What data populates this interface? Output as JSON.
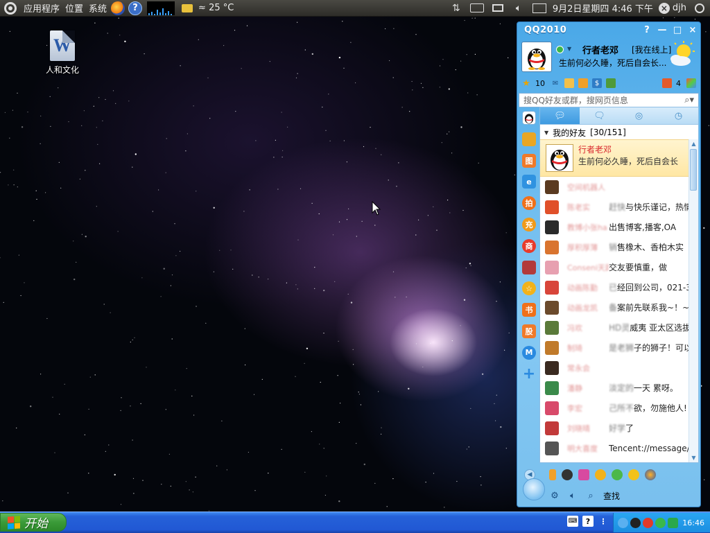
{
  "top_panel": {
    "menus": [
      "应用程序",
      "位置",
      "系统"
    ],
    "weather": "≈ 25 °C",
    "datetime": "9月2日星期四  4:46 下午",
    "username": "djh"
  },
  "desktop": {
    "icon_label": "人和文化",
    "icon_glyph": "W"
  },
  "qq": {
    "title": "QQ2010",
    "win_buttons": [
      "?",
      "—",
      "□",
      "×"
    ],
    "nickname": "行者老邓",
    "status": "[我在线上]",
    "signature": "生前何必久睡，死后自会长...",
    "toolbar": {
      "star_count": "10",
      "mail_count": "4"
    },
    "search_placeholder": "搜QQ好友或群，搜网页信息",
    "group": {
      "name": "我的好友",
      "count": "[30/151]"
    },
    "selected_friend": {
      "name": "行者老邓",
      "signature": "生前何必久睡，死后自会长"
    },
    "sidebar_glyphs": [
      "",
      "",
      "图",
      "e",
      "拍",
      "充",
      "商",
      "",
      "☆",
      "书",
      "股",
      "M",
      "+"
    ],
    "friends": [
      {
        "name": "空间机器人",
        "sig_blur": "",
        "sig": "",
        "color": "#5a3a20"
      },
      {
        "name": "陈老实",
        "sig_blur": "赶快",
        "sig": "与快乐谨记，热情",
        "color": "#e0502a"
      },
      {
        "name": "教博小张ha",
        "sig_blur": "",
        "sig": "出售博客,播客,OA",
        "color": "#2a2a2a"
      },
      {
        "name": "厚积厚薄",
        "sig_blur": "销",
        "sig": "售橡木、香柏木实",
        "color": "#d9742f"
      },
      {
        "name": "Conseni天路",
        "sig_blur": "",
        "sig": "交友要慎重，做",
        "color": "#e7a0b0"
      },
      {
        "name": "动画陈勤",
        "sig_blur": "已",
        "sig": "经回到公司，021-3",
        "color": "#d8453a"
      },
      {
        "name": "动画龙凯",
        "sig_blur": "备",
        "sig": "案前先联系我~！~",
        "color": "#6b4a2c"
      },
      {
        "name": "冯欢",
        "sig_blur": "HD灵",
        "sig": "威夷 亚太区选拔赛",
        "color": "#5a7a3a"
      },
      {
        "name": "制琦",
        "sig_blur": "是老狮",
        "sig": "子的狮子！可以当",
        "color": "#c07a2a"
      },
      {
        "name": "常永会",
        "sig_blur": "",
        "sig": "",
        "color": "#3a2a20"
      },
      {
        "name": "潘静",
        "sig_blur": "淡定的",
        "sig": "一天 累呀。",
        "color": "#3a8a4a"
      },
      {
        "name": "李宏",
        "sig_blur": "己所不",
        "sig": "欲，勿施他人!",
        "color": "#d84a6a"
      },
      {
        "name": "刘晓晴",
        "sig_blur": "好学",
        "sig": "了",
        "color": "#c23a3a"
      },
      {
        "name": "明大喜度",
        "sig_blur": "",
        "sig": "Tencent://message/?ui",
        "color": "#555555"
      }
    ],
    "bottom": {
      "find_label": "查找"
    }
  },
  "taskbar": {
    "start_label": "开始",
    "tray_help": "?",
    "clock": "16:46"
  },
  "colors": {
    "qq_blue": "#4aa8e8",
    "selected_bg": "#ffe7a4",
    "selected_name": "#d8262c",
    "taskbar_blue": "#2158d4",
    "start_green": "#3a9a38"
  }
}
